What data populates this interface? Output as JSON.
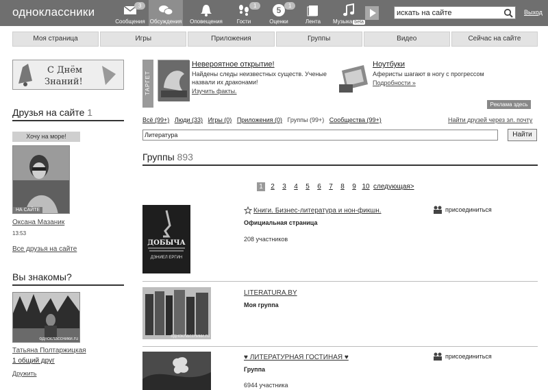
{
  "topbar": {
    "logo": "одноклассники",
    "nav": [
      {
        "icon": "envelope-icon",
        "label": "Сообщения",
        "badge": "3"
      },
      {
        "icon": "chat-bubbles-icon",
        "label": "Обсуждения",
        "badge": ""
      },
      {
        "icon": "bell-icon",
        "label": "Оповещения",
        "badge": ""
      },
      {
        "icon": "footprints-icon",
        "label": "Гости",
        "badge": "1"
      },
      {
        "icon": "rating-five-icon",
        "label": "Оценки",
        "badge": "1",
        "glyph": "5"
      },
      {
        "icon": "feed-icon",
        "label": "Лента",
        "badge": ""
      },
      {
        "icon": "music-note-icon",
        "label": "Музыка",
        "badge": "",
        "beta": "beta"
      }
    ],
    "search_value": "искать на сайте",
    "exit": "Выход"
  },
  "tabs": [
    "Моя страница",
    "Игры",
    "Приложения",
    "Группы",
    "Видео",
    "Сейчас на сайте"
  ],
  "left": {
    "greeting_line1": "С Днём",
    "greeting_line2": "Знаний!",
    "friends_title": "Друзья на сайте",
    "friends_count": "1",
    "status": "Хочу на море!",
    "onsite": "НА САЙТЕ",
    "friend_name": "Оксана Мазаник",
    "friend_time": "13:53",
    "all_friends": "Все друзья на сайте",
    "know_title": "Вы знакомы?",
    "watermark": "одноклассники.ru",
    "person_name": "Татьяна Полтаржицкая",
    "common": "1 общий друг",
    "add_friend": "Дружить"
  },
  "ad": {
    "target": "ТАРГЕТ",
    "a1_title": "Невероятное открытие!",
    "a1_text": "Найдены следы неизвестных существ. Ученые назвали их драконами!",
    "a1_more": "Изучить факты.",
    "a2_title": "Ноутбуки",
    "a2_text": "Аферисты шагают в ногу с прогрессом",
    "a2_more": "Подробности »",
    "label": "Реклама здесь"
  },
  "filters": [
    {
      "text": "Всё (99+)",
      "current": false
    },
    {
      "text": "Люди (33)",
      "current": false
    },
    {
      "text": "Игры (0)",
      "current": false
    },
    {
      "text": "Приложения (0)",
      "current": false
    },
    {
      "text": "Группы (99+)",
      "current": true
    },
    {
      "text": "Сообщества (99+)",
      "current": false
    }
  ],
  "find_by_mail": "Найти друзей через эл. почту",
  "group_search_value": "Литература",
  "find_button": "Найти",
  "groups_title": "Группы",
  "groups_count": "893",
  "pager": [
    "1",
    "2",
    "3",
    "4",
    "5",
    "6",
    "7",
    "8",
    "9",
    "10"
  ],
  "pager_next": "следующая>",
  "groups": [
    {
      "name": "Книги. Бизнес-литература и нон-фикшн.",
      "type": "Официальная страница",
      "members": "208 участников",
      "join": "присоединиться",
      "cover_title": "ДОБЫЧА",
      "cover_author": "ДЭНИЕЛ ЕРГИН"
    },
    {
      "name": "LITERATURA.BY",
      "type": "Моя группа",
      "members": "",
      "join": ""
    },
    {
      "name": "♥ ЛИТЕРАТУРНАЯ ГОСТИНАЯ ♥",
      "type": "Группа",
      "members": "6944 участника",
      "join": "присоединиться"
    }
  ]
}
